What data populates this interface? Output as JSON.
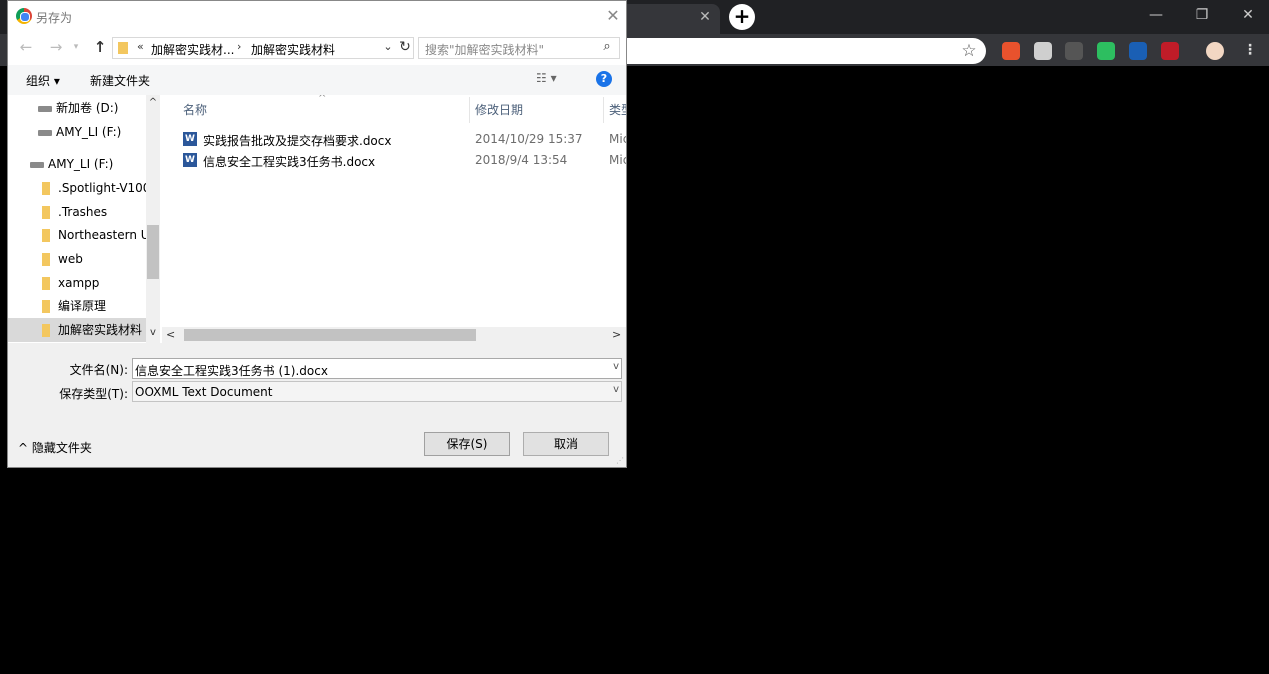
{
  "dialog": {
    "title": "另存为",
    "close_glyph": "✕",
    "nav": {
      "back": "←",
      "forward": "→",
      "recent": "▾",
      "up": "↑"
    },
    "address": {
      "overflow": "«",
      "crumb1": "加解密实践材...",
      "separator": "›",
      "crumb2": "加解密实践材料",
      "dropdown": "⌄",
      "refresh": "↻"
    },
    "search": {
      "placeholder": "搜索\"加解密实践材料\"",
      "icon": "search-icon"
    },
    "toolbar": {
      "organize": "组织 ▾",
      "new_folder": "新建文件夹",
      "view": "☷ ▾",
      "help": "?"
    },
    "navpane": {
      "items": [
        {
          "label": "新加卷 (D:)",
          "icon": "drive-icon"
        },
        {
          "label": "AMY_LI (F:)",
          "icon": "drive-icon"
        },
        {
          "label": "AMY_LI (F:)",
          "icon": "drive-icon"
        },
        {
          "label": ".Spotlight-V100",
          "icon": "folder-icon"
        },
        {
          "label": ".Trashes",
          "icon": "folder-icon"
        },
        {
          "label": "Northeastern U",
          "icon": "folder-icon"
        },
        {
          "label": "web",
          "icon": "folder-icon"
        },
        {
          "label": "xampp",
          "icon": "folder-icon"
        },
        {
          "label": "编译原理",
          "icon": "folder-icon"
        },
        {
          "label": "加解密实践材料",
          "icon": "folder-icon",
          "selected": true
        }
      ]
    },
    "filelist": {
      "columns": {
        "name": "名称",
        "date": "修改日期",
        "type": "类型"
      },
      "sort_glyph": "^",
      "files": [
        {
          "name": "实践报告批改及提交存档要求.docx",
          "date": "2014/10/29 15:37",
          "type": "Mic"
        },
        {
          "name": "信息安全工程实践3任务书.docx",
          "date": "2018/9/4 13:54",
          "type": "Mic"
        }
      ]
    },
    "form": {
      "filename_label": "文件名(N):",
      "filename_value": "信息安全工程实践3任务书 (1).docx",
      "filetype_label": "保存类型(T):",
      "filetype_value": "OOXML Text Document"
    },
    "footer": {
      "hide_folders": "^ 隐藏文件夹",
      "save": "保存(S)",
      "cancel": "取消"
    }
  },
  "browser": {
    "tab_close": "✕",
    "new_tab": "+",
    "window": {
      "minimize": "—",
      "maximize": "❐",
      "close": "✕"
    },
    "bookmark_star": "☆",
    "extensions": [
      {
        "name": "infinity-extension-icon",
        "color": "#e8522d"
      },
      {
        "name": "shield-extension-icon",
        "color": "#cfcfcf"
      },
      {
        "name": "c-extension-icon",
        "color": "#555555"
      },
      {
        "name": "evernote-extension-icon",
        "color": "#2dbe60"
      },
      {
        "name": "blue-extension-icon",
        "color": "#1a5fb4"
      },
      {
        "name": "red-extension-icon",
        "color": "#c01c28"
      },
      {
        "name": "avatar-icon",
        "color": "#f2d7c3"
      }
    ]
  }
}
